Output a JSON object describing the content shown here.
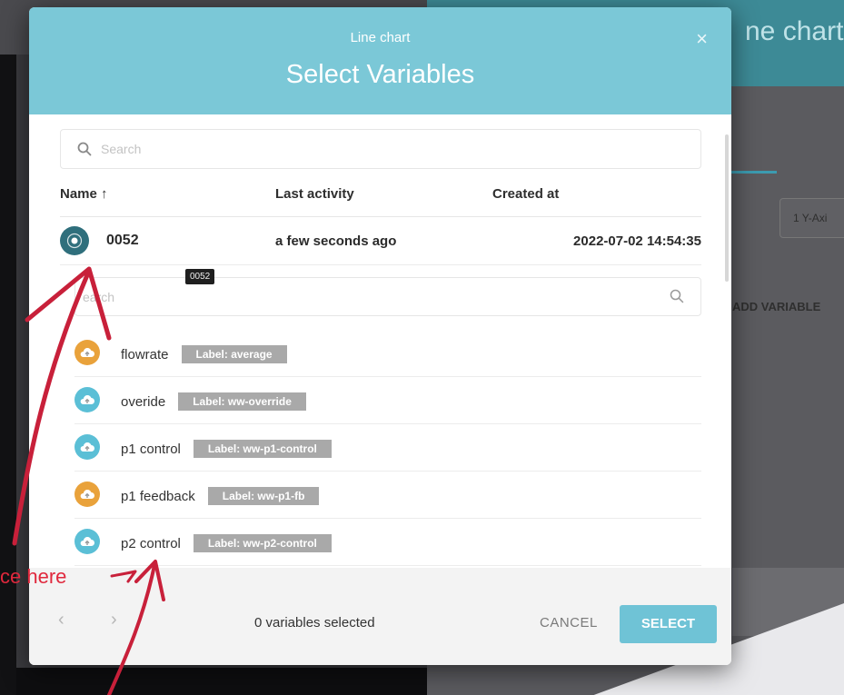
{
  "background": {
    "title": "ne chart",
    "y_axis_select": "1 Y-Axi",
    "add_variable": "ADD VARIABLE"
  },
  "modal": {
    "subtitle": "Line chart",
    "title": "Select Variables",
    "close": "×",
    "device_search_placeholder": "Search",
    "columns": {
      "name": "Name ↑",
      "last_activity": "Last activity",
      "created_at": "Created at"
    },
    "device": {
      "name": "0052",
      "last_activity": "a few seconds ago",
      "created_at": "2022-07-02 14:54:35",
      "tooltip": "0052"
    },
    "variable_search_placeholder": "earch",
    "variables": [
      {
        "name": "flowrate",
        "label": "Label: average",
        "icon_color": "#e9a23b"
      },
      {
        "name": "overide",
        "label": "Label: ww-override",
        "icon_color": "#5bbfd6"
      },
      {
        "name": "p1 control",
        "label": "Label: ww-p1-control",
        "icon_color": "#5bbfd6"
      },
      {
        "name": "p1 feedback",
        "label": "Label: ww-p1-fb",
        "icon_color": "#e9a23b"
      },
      {
        "name": "p2 control",
        "label": "Label: ww-p2-control",
        "icon_color": "#5bbfd6"
      }
    ],
    "footer": {
      "prev": "‹",
      "next": "›",
      "selected_count": "0 variables selected",
      "cancel": "CANCEL",
      "select": "SELECT"
    }
  },
  "annotation": {
    "text": "ce here",
    "color": "#e0283d"
  }
}
